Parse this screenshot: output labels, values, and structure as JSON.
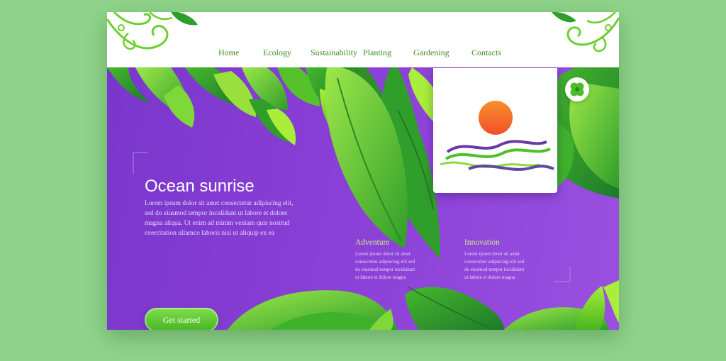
{
  "nav": {
    "items": [
      {
        "label": "Home"
      },
      {
        "label": "Ecology"
      },
      {
        "label": "Sustainability"
      },
      {
        "label": "Planting"
      },
      {
        "label": "Gardening"
      },
      {
        "label": "Contacts"
      }
    ]
  },
  "hero": {
    "title": "Ocean sunrise",
    "paragraph": [
      "Lorem ipsum dolor sit amet consectetur adipiscing elit,",
      "sed do eiusmod tempor incididunt ut labore et dolore",
      "magna aliqua. Ut enim ad minim veniam quis nostrud",
      "exercitation ullamco laboris nisi ut aliquip ex ea"
    ],
    "cta_label": "Get started"
  },
  "columns": [
    {
      "title": "Adventure",
      "lines": [
        "Lorem ipsum dolor sit amet",
        "consectetur adipiscing elit sed",
        "do eiusmod tempor incididunt",
        "ut labore et dolore magna"
      ]
    },
    {
      "title": "Innovation",
      "lines": [
        "Lorem ipsum dolor sit amet",
        "consectetur adipiscing elit sed",
        "do eiusmod tempor incididunt",
        "ut labore et dolore magna"
      ]
    }
  ],
  "colors": {
    "background": "#8fd48a",
    "hero_purple": "#8a3fd6",
    "leaf_green": "#4cc432",
    "accent_green": "#5fce2c",
    "sun_orange": "#f7902a"
  },
  "icons": {
    "logo": "ocean-sunrise-logo-icon",
    "badge": "clover-icon"
  }
}
